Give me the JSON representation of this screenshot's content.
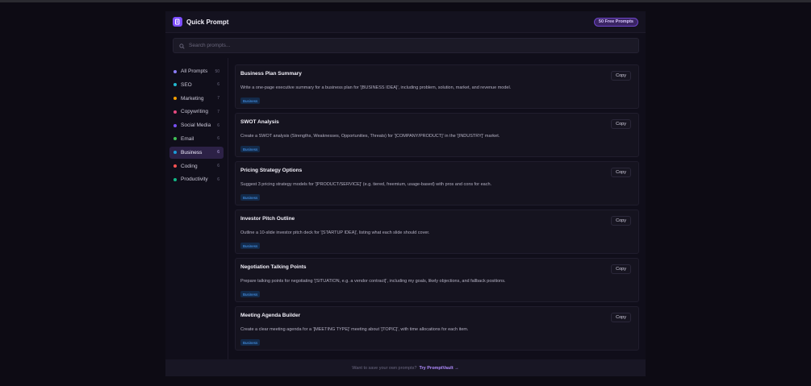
{
  "header": {
    "title": "Quick Prompt",
    "badge": "50 Free Prompts",
    "logo_icon": "document-icon",
    "accent": "#7c4dff"
  },
  "search": {
    "placeholder": "Search prompts...",
    "value": ""
  },
  "sidebar": {
    "items": [
      {
        "label": "All Prompts",
        "count": "50",
        "color": "#8b7cf6",
        "active": false
      },
      {
        "label": "SEO",
        "count": "6",
        "color": "#22b8cf",
        "active": false
      },
      {
        "label": "Marketing",
        "count": "7",
        "color": "#f59f00",
        "active": false
      },
      {
        "label": "Copywriting",
        "count": "7",
        "color": "#e64980",
        "active": false
      },
      {
        "label": "Social Media",
        "count": "6",
        "color": "#7950f2",
        "active": false
      },
      {
        "label": "Email",
        "count": "6",
        "color": "#40c057",
        "active": false
      },
      {
        "label": "Business",
        "count": "6",
        "color": "#1c9bd8",
        "active": true
      },
      {
        "label": "Coding",
        "count": "6",
        "color": "#fa5252",
        "active": false
      },
      {
        "label": "Productivity",
        "count": "6",
        "color": "#12b886",
        "active": false
      }
    ]
  },
  "prompts": [
    {
      "title": "Business Plan Summary",
      "text": "Write a one-page executive summary for a business plan for '[BUSINESS IDEA]', including problem, solution, market, and revenue model.",
      "tag": "Business",
      "copy": "Copy"
    },
    {
      "title": "SWOT Analysis",
      "text": "Create a SWOT analysis (Strengths, Weaknesses, Opportunities, Threats) for '[COMPANY/PRODUCT]' in the '[INDUSTRY]' market.",
      "tag": "Business",
      "copy": "Copy"
    },
    {
      "title": "Pricing Strategy Options",
      "text": "Suggest 3 pricing strategy models for '[PRODUCT/SERVICE]' (e.g. tiered, freemium, usage-based) with pros and cons for each.",
      "tag": "Business",
      "copy": "Copy"
    },
    {
      "title": "Investor Pitch Outline",
      "text": "Outline a 10-slide investor pitch deck for '[STARTUP IDEA]', listing what each slide should cover.",
      "tag": "Business",
      "copy": "Copy"
    },
    {
      "title": "Negotiation Talking Points",
      "text": "Prepare talking points for negotiating '[SITUATION, e.g. a vendor contract]', including my goals, likely objections, and fallback positions.",
      "tag": "Business",
      "copy": "Copy"
    },
    {
      "title": "Meeting Agenda Builder",
      "text": "Create a clear meeting agenda for a '[MEETING TYPE]' meeting about '[TOPIC]', with time allocations for each item.",
      "tag": "Business",
      "copy": "Copy"
    }
  ],
  "footer": {
    "text": "Want to save your own prompts?",
    "link": "Try PromptVault →"
  }
}
